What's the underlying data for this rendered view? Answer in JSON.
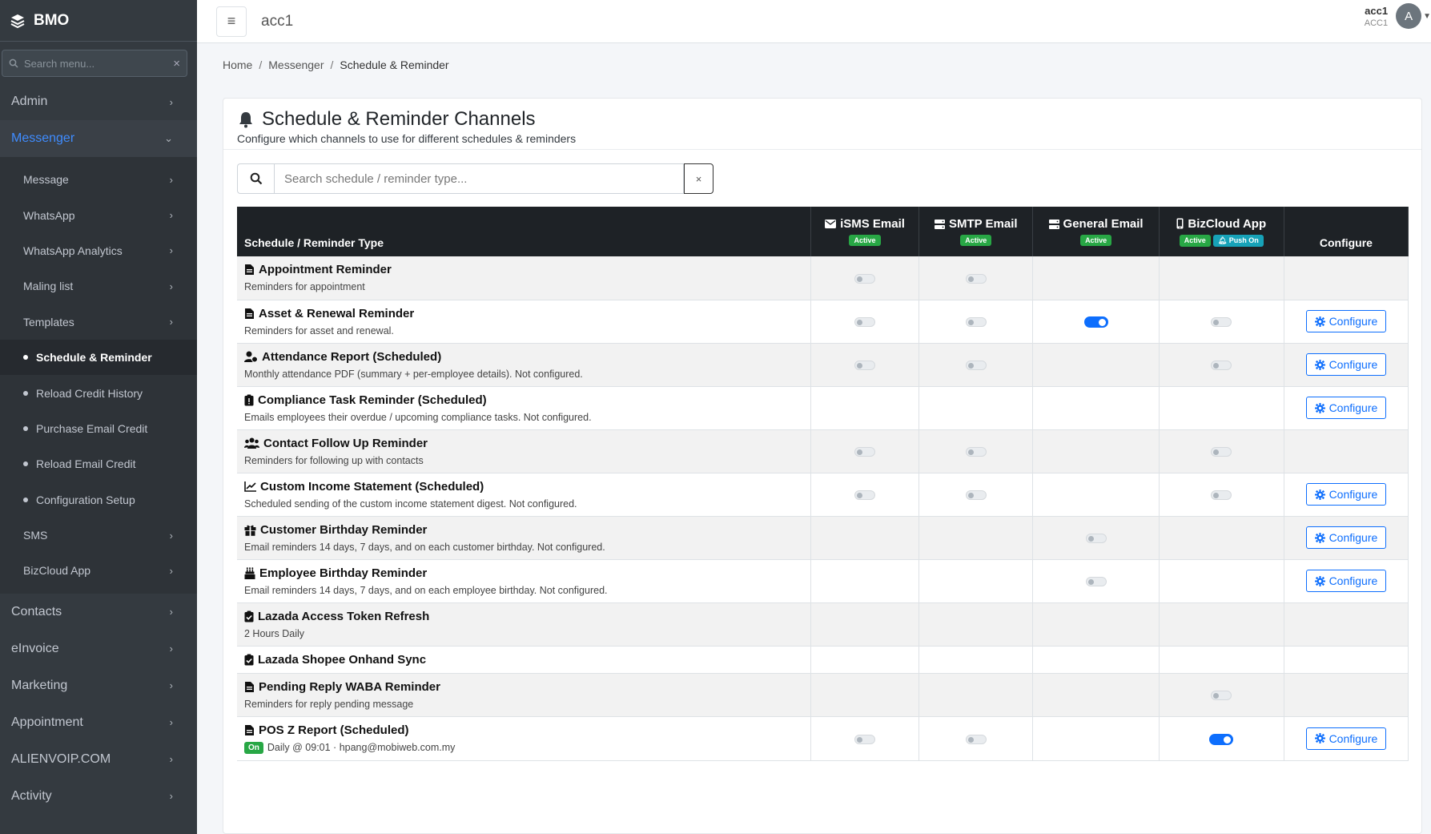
{
  "app": {
    "name": "BMO"
  },
  "sidebar": {
    "search_placeholder": "Search menu...",
    "items": [
      {
        "label": "Admin",
        "expanded": false
      },
      {
        "label": "Messenger",
        "expanded": true
      }
    ],
    "messenger_children": [
      {
        "label": "Message",
        "type": "chevron"
      },
      {
        "label": "WhatsApp",
        "type": "chevron"
      },
      {
        "label": "WhatsApp Analytics",
        "type": "chevron"
      },
      {
        "label": "Maling list",
        "type": "chevron"
      },
      {
        "label": "Templates",
        "type": "chevron"
      },
      {
        "label": "Schedule & Reminder",
        "type": "dot",
        "current": true
      },
      {
        "label": "Reload Credit History",
        "type": "dot"
      },
      {
        "label": "Purchase Email Credit",
        "type": "dot"
      },
      {
        "label": "Reload Email Credit",
        "type": "dot"
      },
      {
        "label": "Configuration Setup",
        "type": "dot"
      },
      {
        "label": "SMS",
        "type": "chevron"
      },
      {
        "label": "BizCloud App",
        "type": "chevron"
      }
    ],
    "bottom_items": [
      "Contacts",
      "eInvoice",
      "Marketing",
      "Appointment",
      "ALIENVOIP.COM",
      "Activity"
    ]
  },
  "topbar": {
    "account_title": "acc1",
    "user_name": "acc1",
    "user_code": "ACC1",
    "avatar_letter": "A"
  },
  "breadcrumb": [
    "Home",
    "Messenger",
    "Schedule & Reminder"
  ],
  "card": {
    "title": "Schedule & Reminder Channels",
    "subtitle": "Configure which channels to use for different schedules & reminders",
    "search_placeholder": "Search schedule / reminder type...",
    "clear_label": "×"
  },
  "table": {
    "col_type": "Schedule / Reminder Type",
    "col_configure": "Configure",
    "channels": [
      {
        "name": "iSMS Email",
        "badges": [
          "Active"
        ]
      },
      {
        "name": "SMTP Email",
        "badges": [
          "Active"
        ]
      },
      {
        "name": "General Email",
        "badges": [
          "Active"
        ]
      },
      {
        "name": "BizCloud App",
        "badges": [
          "Active",
          "Push On"
        ]
      }
    ],
    "configure_label": "Configure",
    "on_label": "On",
    "rows": [
      {
        "title": "Appointment Reminder",
        "desc": "Reminders for appointment",
        "icon": "doc",
        "toggles": [
          "off",
          "off",
          null,
          null
        ],
        "configure": false
      },
      {
        "title": "Asset & Renewal Reminder",
        "desc": "Reminders for asset and renewal.",
        "icon": "doc",
        "toggles": [
          "off",
          "off",
          "on",
          "off"
        ],
        "configure": true
      },
      {
        "title": "Attendance Report (Scheduled)",
        "desc": "Monthly attendance PDF (summary + per-employee details). Not configured.",
        "icon": "user-clock",
        "toggles": [
          "off",
          "off",
          null,
          "off"
        ],
        "configure": true
      },
      {
        "title": "Compliance Task Reminder (Scheduled)",
        "desc": "Emails employees their overdue / upcoming compliance tasks. Not configured.",
        "icon": "clipboard",
        "toggles": [
          null,
          null,
          null,
          null
        ],
        "configure": true
      },
      {
        "title": "Contact Follow Up Reminder",
        "desc": "Reminders for following up with contacts",
        "icon": "users",
        "toggles": [
          "off",
          "off",
          null,
          "off"
        ],
        "configure": false
      },
      {
        "title": "Custom Income Statement (Scheduled)",
        "desc": "Scheduled sending of the custom income statement digest. Not configured.",
        "icon": "chart",
        "toggles": [
          "off",
          "off",
          null,
          "off"
        ],
        "configure": true
      },
      {
        "title": "Customer Birthday Reminder",
        "desc": "Email reminders 14 days, 7 days, and on each customer birthday. Not configured.",
        "icon": "gift",
        "toggles": [
          null,
          null,
          "off",
          null
        ],
        "configure": true
      },
      {
        "title": "Employee Birthday Reminder",
        "desc": "Email reminders 14 days, 7 days, and on each employee birthday. Not configured.",
        "icon": "cake",
        "toggles": [
          null,
          null,
          "off",
          null
        ],
        "configure": true
      },
      {
        "title": "Lazada Access Token Refresh",
        "desc": "2 Hours Daily",
        "icon": "clipboard-check",
        "toggles": [
          null,
          null,
          null,
          null
        ],
        "configure": false
      },
      {
        "title": "Lazada Shopee Onhand Sync",
        "desc": "",
        "icon": "clipboard-check",
        "toggles": [
          null,
          null,
          null,
          null
        ],
        "configure": false
      },
      {
        "title": "Pending Reply WABA Reminder",
        "desc": "Reminders for reply pending message",
        "icon": "doc",
        "toggles": [
          null,
          null,
          null,
          "off"
        ],
        "configure": false
      },
      {
        "title": "POS Z Report (Scheduled)",
        "desc": "Daily @ 09:01 · hpang@mobiweb.com.my",
        "icon": "doc",
        "status": "On",
        "toggles": [
          "off",
          "off",
          null,
          "on"
        ],
        "configure": true
      }
    ]
  }
}
